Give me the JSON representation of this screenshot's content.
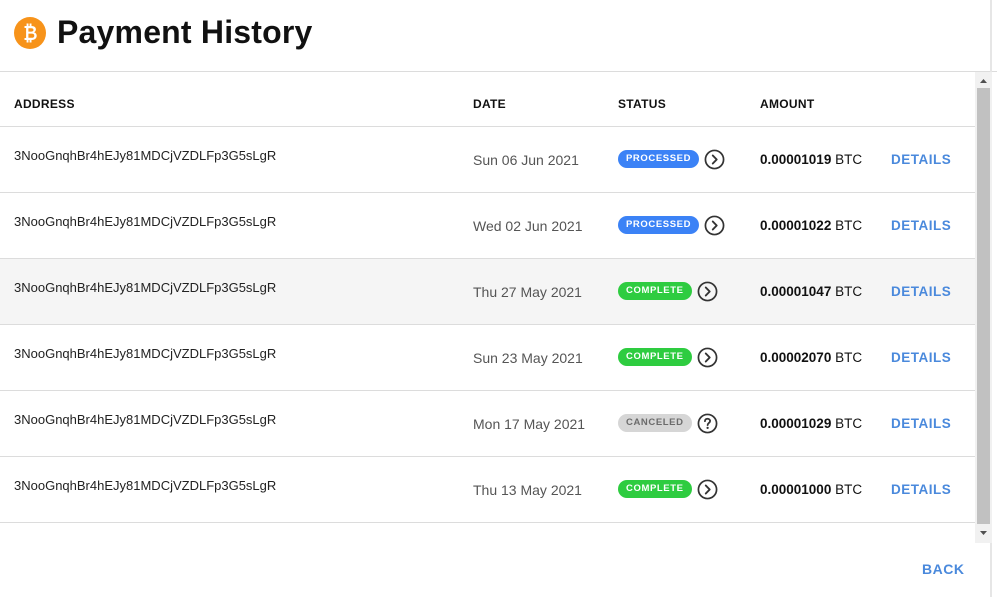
{
  "header": {
    "title": "Payment History",
    "logo_color": "#f7931a"
  },
  "table": {
    "columns": {
      "address": "ADDRESS",
      "date": "DATE",
      "status": "STATUS",
      "amount": "AMOUNT"
    },
    "rows": [
      {
        "address": "3NooGnqhBr4hEJy81MDCjVZDLFp3G5sLgR",
        "date": "Sun 06 Jun 2021",
        "status": "PROCESSED",
        "status_icon": "chevron-right-circle-icon",
        "amount": "0.00001019",
        "unit": "BTC",
        "action": "DETAILS"
      },
      {
        "address": "3NooGnqhBr4hEJy81MDCjVZDLFp3G5sLgR",
        "date": "Wed 02 Jun 2021",
        "status": "PROCESSED",
        "status_icon": "chevron-right-circle-icon",
        "amount": "0.00001022",
        "unit": "BTC",
        "action": "DETAILS"
      },
      {
        "address": "3NooGnqhBr4hEJy81MDCjVZDLFp3G5sLgR",
        "date": "Thu 27 May 2021",
        "status": "COMPLETE",
        "status_icon": "chevron-right-circle-icon",
        "amount": "0.00001047",
        "unit": "BTC",
        "action": "DETAILS"
      },
      {
        "address": "3NooGnqhBr4hEJy81MDCjVZDLFp3G5sLgR",
        "date": "Sun 23 May 2021",
        "status": "COMPLETE",
        "status_icon": "chevron-right-circle-icon",
        "amount": "0.00002070",
        "unit": "BTC",
        "action": "DETAILS"
      },
      {
        "address": "3NooGnqhBr4hEJy81MDCjVZDLFp3G5sLgR",
        "date": "Mon 17 May 2021",
        "status": "CANCELED",
        "status_icon": "question-circle-icon",
        "amount": "0.00001029",
        "unit": "BTC",
        "action": "DETAILS"
      },
      {
        "address": "3NooGnqhBr4hEJy81MDCjVZDLFp3G5sLgR",
        "date": "Thu 13 May 2021",
        "status": "COMPLETE",
        "status_icon": "chevron-right-circle-icon",
        "amount": "0.00001000",
        "unit": "BTC",
        "action": "DETAILS"
      }
    ]
  },
  "colors": {
    "processed": "#3b82f6",
    "complete": "#2ecc40",
    "canceled": "#d6d6d6",
    "link": "#4a89dc"
  },
  "footer": {
    "back_label": "BACK"
  }
}
